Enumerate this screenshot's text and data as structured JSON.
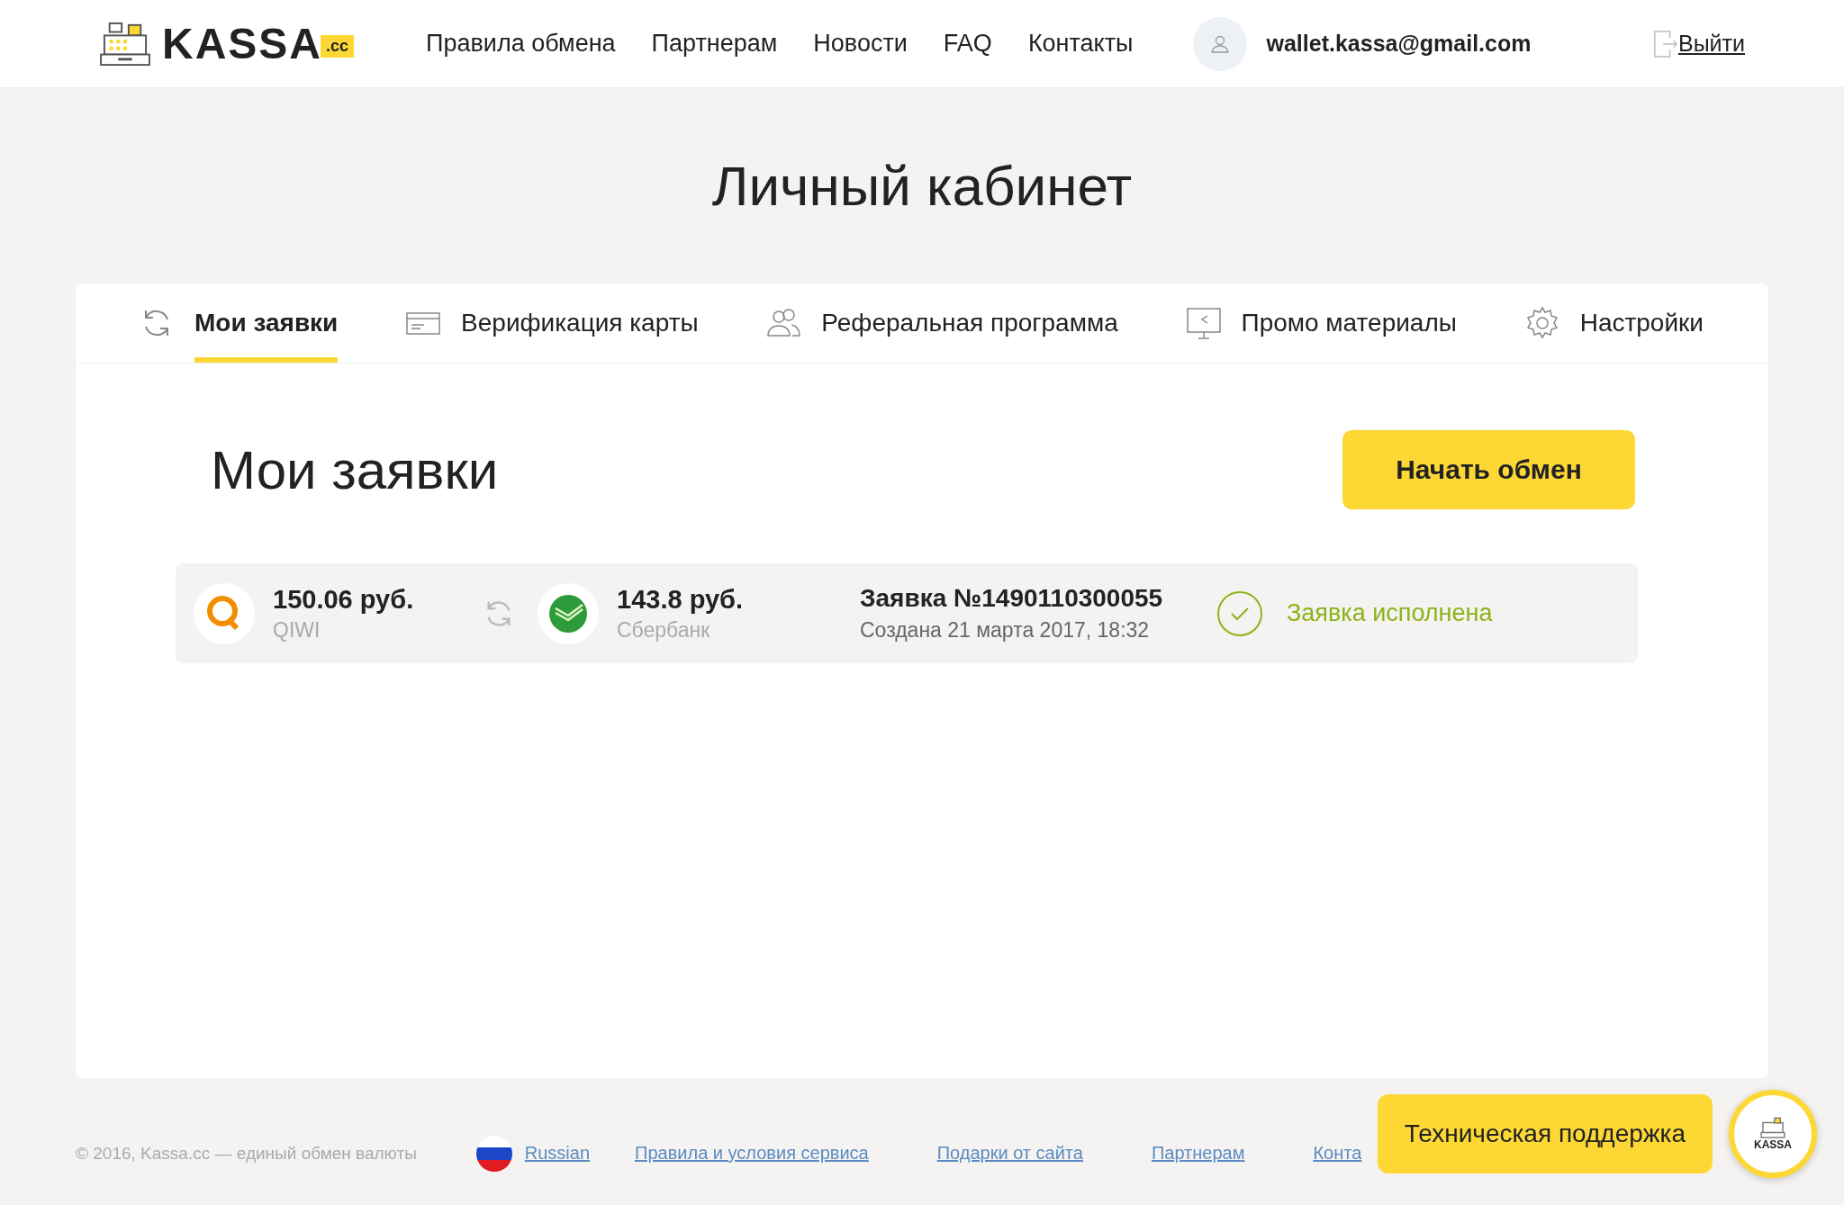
{
  "header": {
    "logo": {
      "name": "KASSA",
      "badge": ".cc"
    },
    "nav": [
      "Правила обмена",
      "Партнерам",
      "Новости",
      "FAQ",
      "Контакты"
    ],
    "user": {
      "email": "wallet.kassa@gmail.com"
    },
    "logout": "Выйти"
  },
  "page_title": "Личный кабинет",
  "tabs": [
    {
      "label": "Мои заявки",
      "kind": "orders",
      "selected": true
    },
    {
      "label": "Верификация карты",
      "kind": "verification",
      "selected": false
    },
    {
      "label": "Реферальная программа",
      "kind": "referral",
      "selected": false
    },
    {
      "label": "Промо материалы",
      "kind": "promo",
      "selected": false
    },
    {
      "label": "Настройки",
      "kind": "settings",
      "selected": false
    }
  ],
  "section": {
    "title": "Мои заявки",
    "button": "Начать обмен"
  },
  "orders": [
    {
      "from": {
        "amount": "150.06 руб.",
        "currency": "QIWI",
        "kind": "qiwi"
      },
      "to": {
        "amount": "143.8 руб.",
        "currency": "Сбербанк",
        "kind": "sber"
      },
      "title": "Заявка №1490110300055",
      "created": "Создана 21 марта 2017, 18:32",
      "status": "Заявка исполнена",
      "kind": "done"
    }
  ],
  "footer": {
    "copyright": "© 2016, Kassa.cc — единый обмен валюты",
    "language": "Russian",
    "links": [
      "Правила и условия сервиса",
      "Подарки от сайта",
      "Партнерам",
      "Конта"
    ]
  },
  "support": {
    "label": "Техническая поддержка",
    "logo": "KASSA"
  }
}
